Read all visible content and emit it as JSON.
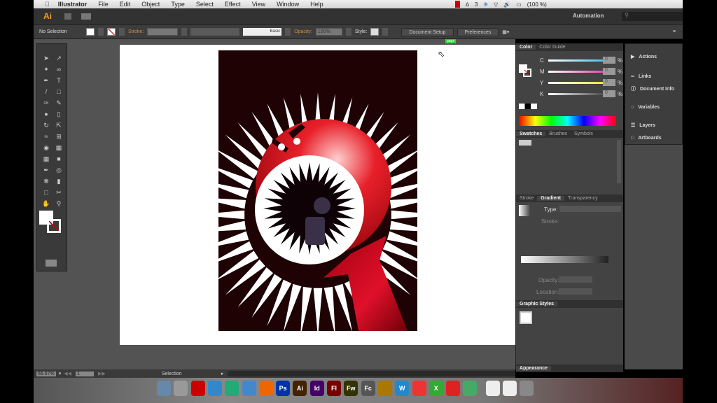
{
  "menubar": {
    "app": "Illustrator",
    "items": [
      "File",
      "Edit",
      "Object",
      "Type",
      "Select",
      "Effect",
      "View",
      "Window",
      "Help"
    ],
    "status": {
      "adobe_count": "3",
      "battery": "(100 %)"
    }
  },
  "appbar": {
    "logo": "Ai",
    "workspace": "Automation",
    "search_placeholder": ""
  },
  "control": {
    "selection": "No Selection",
    "stroke_label": "Stroke:",
    "brush": "Basic",
    "opacity_label": "Opacity:",
    "opacity": "100%",
    "style_label": "Style:",
    "document_setup": "Document Setup",
    "preferences": "Preferences"
  },
  "canvas": {
    "tooltip": "page",
    "colors": {
      "background": "#1e0204",
      "spikes": "#ffffff",
      "monster": "#d4101c"
    }
  },
  "color_panel": {
    "tabs": [
      "Color",
      "Color Guide"
    ],
    "channels": [
      {
        "label": "C",
        "value": "0"
      },
      {
        "label": "M",
        "value": "0"
      },
      {
        "label": "Y",
        "value": "0"
      },
      {
        "label": "K",
        "value": "0"
      }
    ],
    "unit": "%"
  },
  "swatches_panel": {
    "tabs": [
      "Swatches",
      "Brushes",
      "Symbols"
    ]
  },
  "gradient_panel": {
    "tabs": [
      "Stroke",
      "Gradient",
      "Transparency"
    ],
    "type_label": "Type:",
    "stroke_label": "Stroke:",
    "opacity_label": "Opacity:",
    "location_label": "Location:"
  },
  "graphic_styles": {
    "title": "Graphic Styles"
  },
  "appearance": {
    "title": "Appearance"
  },
  "side_panels": [
    "Actions",
    "Links",
    "Document Info",
    "Variables",
    "Layers",
    "Artboards"
  ],
  "statusbar": {
    "zoom": "66.67%",
    "artboard": "1",
    "tool": "Selection"
  },
  "dock": [
    "Finder",
    "Launchpad",
    "Photo Booth",
    "App Store",
    "iTunes",
    "Safari",
    "Firefox",
    "Ps",
    "Ai",
    "Id",
    "Fl",
    "Fw",
    "Fc",
    "Keynote",
    "W",
    "Pages",
    "X",
    "PDF",
    "Preview",
    "Doc",
    "Doc",
    "Trash"
  ]
}
